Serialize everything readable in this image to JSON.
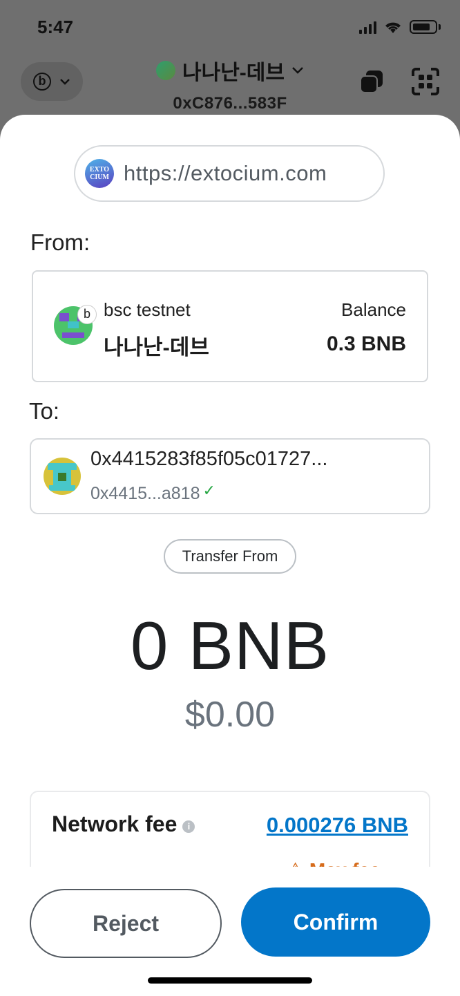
{
  "status_bar": {
    "time": "5:47"
  },
  "header": {
    "account_name": "나나난-데브",
    "account_address": "0xC876...583F",
    "network_letter": "b"
  },
  "origin": {
    "logo_text": "EXTOCIUM",
    "url": "https://extocium.com"
  },
  "from": {
    "label": "From:",
    "network": "bsc testnet",
    "badge": "b",
    "account_name": "나나난-데브",
    "balance_label": "Balance",
    "balance_value": "0.3 BNB"
  },
  "to": {
    "label": "To:",
    "address_full": "0x4415283f85f05c01727...",
    "address_short": "0x4415...a818"
  },
  "transaction": {
    "type_tag": "Transfer From",
    "amount": "0 BNB",
    "fiat": "$0.00"
  },
  "fee": {
    "label": "Network fee",
    "value": "0.000276 BNB",
    "partial_text": "⚠ Max fee"
  },
  "buttons": {
    "reject": "Reject",
    "confirm": "Confirm"
  },
  "colors": {
    "primary": "#0376c9",
    "success": "#28a745",
    "warning": "#d66b1a"
  }
}
